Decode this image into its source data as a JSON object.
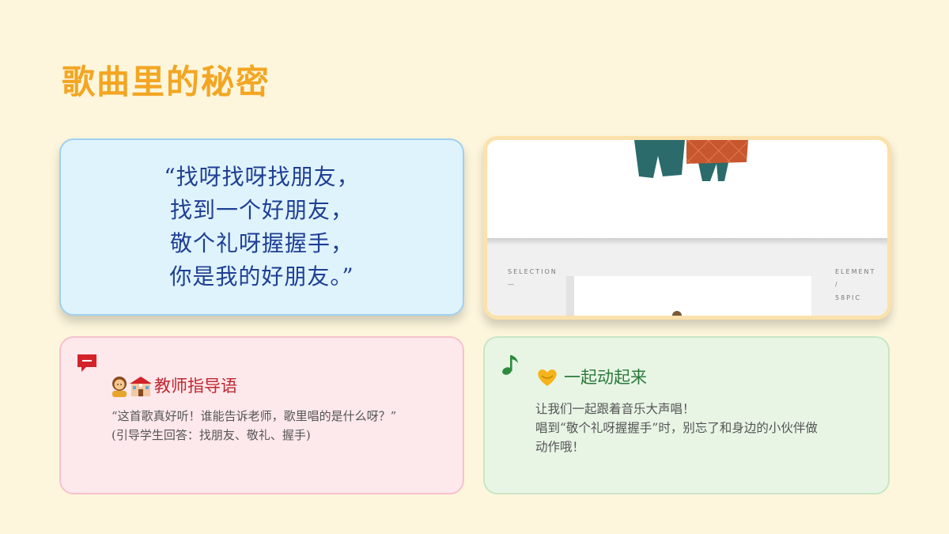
{
  "title": "歌曲里的秘密",
  "lyrics": {
    "lines": [
      "“找呀找呀找朋友，",
      "找到一个好朋友，",
      "敬个礼呀握握手，",
      "你是我的好朋友。”"
    ]
  },
  "image": {
    "label_left": "SELECTION",
    "label_left_dash": "—",
    "label_right": "ELEMENT",
    "label_right_slash": "/",
    "label_right_sub": "58PIC"
  },
  "teacher": {
    "badge_icon": "speech-bubble-icon",
    "emoji": "teacher-school-emoji",
    "heading": "教师指导语",
    "lines": [
      "“这首歌真好听！谁能告诉老师，歌里唱的是什么呀？”",
      "(引导学生回答：找朋友、敬礼、握手)"
    ]
  },
  "move": {
    "note_icon": "music-note-icon",
    "emoji": "heart-hands-emoji",
    "heading": "一起动起来",
    "lines": [
      "让我们一起跟着音乐大声唱！",
      "唱到“敬个礼呀握握手”时，别忘了和身边的小伙伴做",
      "动作哦！"
    ]
  },
  "colors": {
    "background": "#fdf6dc",
    "title": "#f3a623",
    "lyrics_text": "#1e3f94",
    "teacher_heading": "#c0262d",
    "move_heading": "#2b7a3a"
  }
}
